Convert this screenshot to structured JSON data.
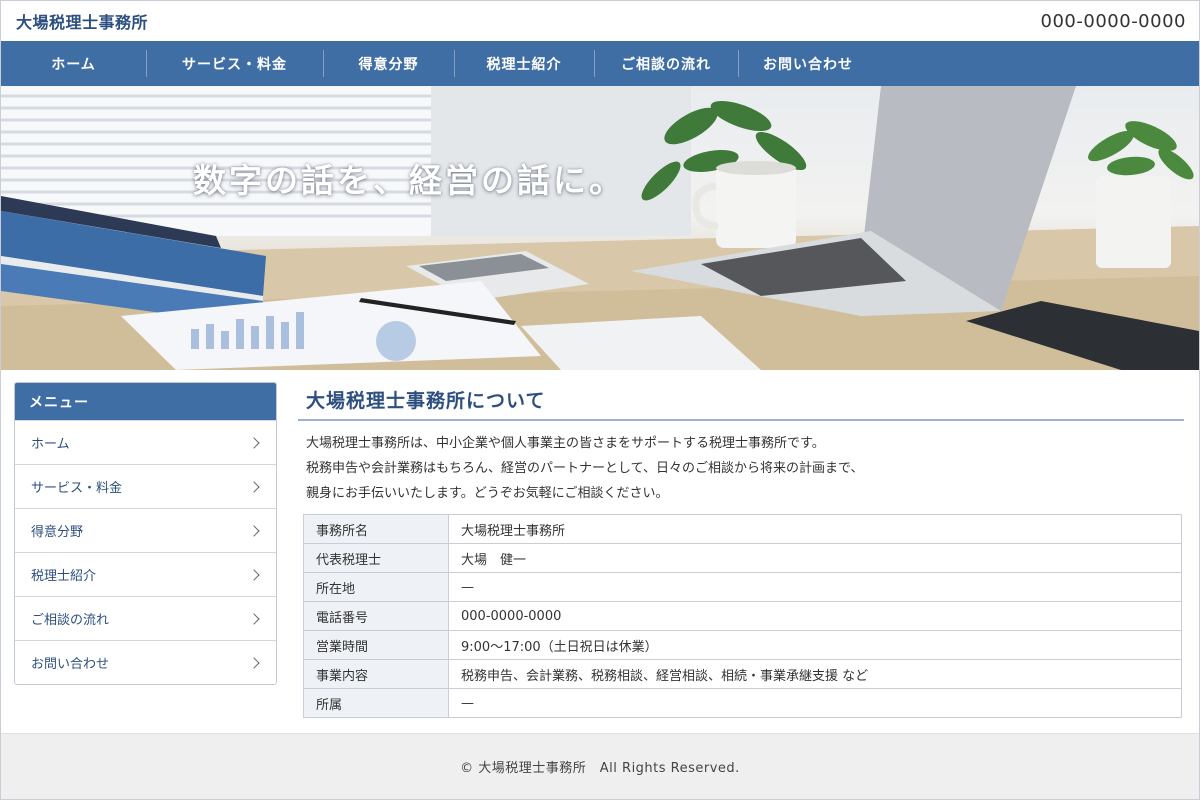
{
  "header": {
    "site_title": "大場税理士事務所",
    "phone": "000-0000-0000"
  },
  "nav": {
    "items": [
      {
        "label": "ホーム"
      },
      {
        "label": "サービス・料金"
      },
      {
        "label": "得意分野"
      },
      {
        "label": "税理士紹介"
      },
      {
        "label": "ご相談の流れ"
      },
      {
        "label": "お問い合わせ"
      }
    ]
  },
  "hero": {
    "catchphrase": "数字の話を、経営の話に。"
  },
  "sidebar": {
    "heading": "メニュー",
    "items": [
      {
        "label": "ホーム"
      },
      {
        "label": "サービス・料金"
      },
      {
        "label": "得意分野"
      },
      {
        "label": "税理士紹介"
      },
      {
        "label": "ご相談の流れ"
      },
      {
        "label": "お問い合わせ"
      }
    ]
  },
  "main": {
    "title": "大場税理士事務所について",
    "intro": [
      "大場税理士事務所は、中小企業や個人事業主の皆さまをサポートする税理士事務所です。",
      "税務申告や会計業務はもちろん、経営のパートナーとして、日々のご相談から将来の計画まで、",
      "親身にお手伝いいたします。どうぞお気軽にご相談ください。"
    ],
    "table": [
      {
        "label": "事務所名",
        "value": "大場税理士事務所"
      },
      {
        "label": "代表税理士",
        "value": "大場　健一"
      },
      {
        "label": "所在地",
        "value": "—"
      },
      {
        "label": "電話番号",
        "value": "000-0000-0000"
      },
      {
        "label": "営業時間",
        "value": "9:00〜17:00（土日祝日は休業）"
      },
      {
        "label": "事業内容",
        "value": "税務申告、会計業務、税務相談、経営相談、相続・事業承継支援 など"
      },
      {
        "label": "所属",
        "value": "—"
      }
    ]
  },
  "footer": {
    "copyright": "© 大場税理士事務所　All Rights Reserved."
  },
  "colors": {
    "primary": "#3f6ea4",
    "title_text": "#2d4f7f",
    "table_header_bg": "#eef2f7",
    "footer_bg": "#efefef"
  }
}
